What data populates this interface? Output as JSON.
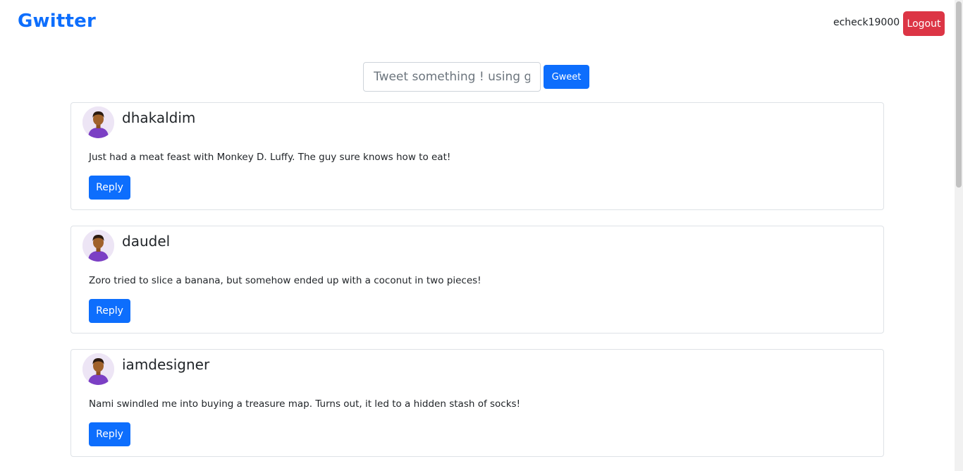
{
  "header": {
    "brand": "Gwitter",
    "username": "echeck19000",
    "logout_label": "Logout"
  },
  "compose": {
    "placeholder": "Tweet something ! using gwitter",
    "submit_label": "Gweet"
  },
  "tweets": [
    {
      "username": "dhakaldim",
      "text": "Just had a meat feast with Monkey D. Luffy. The guy sure knows how to eat!",
      "reply_label": "Reply"
    },
    {
      "username": "daudel",
      "text": "Zoro tried to slice a banana, but somehow ended up with a coconut in two pieces!",
      "reply_label": "Reply"
    },
    {
      "username": "iamdesigner",
      "text": "Nami swindled me into buying a treasure map. Turns out, it led to a hidden stash of socks!",
      "reply_label": "Reply"
    }
  ],
  "colors": {
    "brand": "#0d6efd",
    "primary": "#0d6efd",
    "danger": "#dc3545",
    "avatar_bg": "#ede5f5",
    "avatar_shirt": "#7b3fc4",
    "avatar_skin": "#a0612b"
  },
  "icons": {
    "avatar": "user-avatar-icon"
  }
}
